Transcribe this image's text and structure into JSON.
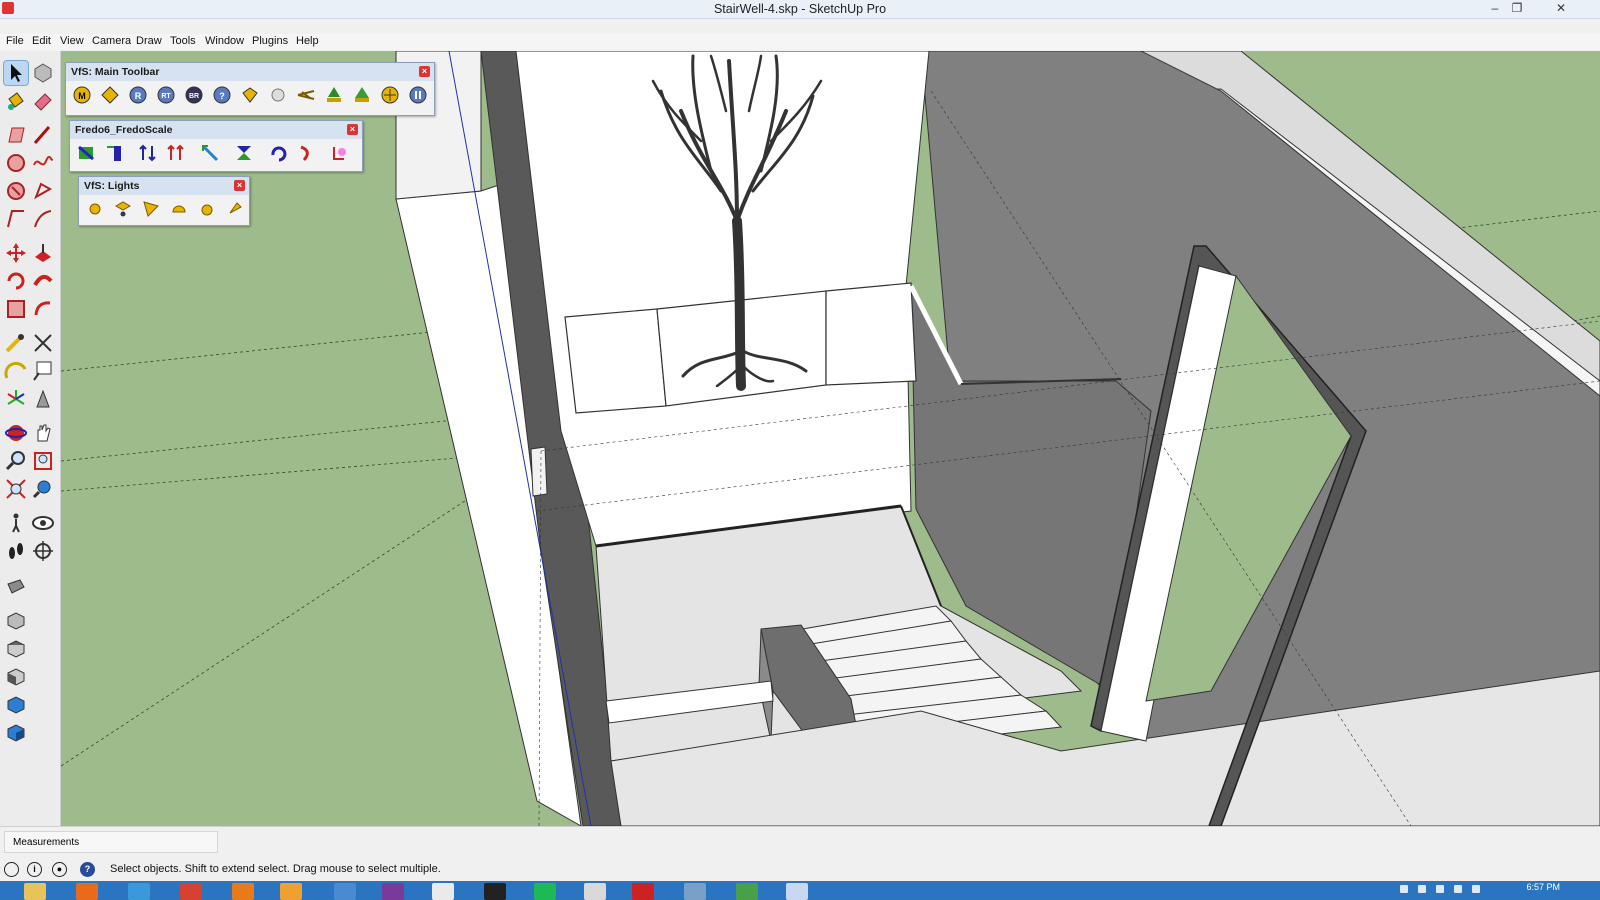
{
  "window": {
    "title": "StairWell-4.skp - SketchUp Pro",
    "controls": [
      "–",
      "❐",
      "✕"
    ]
  },
  "menubar": {
    "items": [
      "File",
      "Edit",
      "View",
      "Camera",
      "Draw",
      "Tools",
      "Window",
      "Plugins",
      "Help"
    ]
  },
  "toolbars": {
    "main": {
      "title": "VfS: Main Toolbar",
      "buttons": [
        "M",
        "",
        "R",
        "RT",
        "BR",
        "?",
        "",
        "",
        "",
        "",
        "",
        "",
        ""
      ]
    },
    "fredo": {
      "title": "Fredo6_FredoScale"
    },
    "lights": {
      "title": "VfS: Lights"
    }
  },
  "measurements": {
    "label": "Measurements"
  },
  "status": {
    "text": "Select objects. Shift to extend select. Drag mouse to select multiple."
  },
  "taskbar": {
    "clock": "6:57 PM"
  },
  "colors": {
    "viewport_ground": "#9dbb8b",
    "taskbar": "#2a74c0",
    "wall_dark": "#808080",
    "wall_light": "#ffffff",
    "floor": "#e4e4e4"
  },
  "icons": [
    "select-icon",
    "component-icon",
    "paint-bucket-icon",
    "eraser-icon",
    "rectangle-icon",
    "line-icon",
    "circle-icon",
    "freehand-icon",
    "polygon-icon",
    "arc-icon",
    "move-icon",
    "push-pull-icon",
    "rotate-icon",
    "follow-me-icon",
    "scale-icon",
    "offset-icon",
    "tape-measure-icon",
    "dimension-icon",
    "protractor-icon",
    "text-icon",
    "axes-icon",
    "3d-text-icon",
    "orbit-icon",
    "pan-icon",
    "zoom-icon",
    "zoom-window-icon",
    "zoom-extents-icon",
    "previous-view-icon",
    "walk-icon",
    "look-around-icon",
    "footprints-icon",
    "position-camera-icon"
  ]
}
